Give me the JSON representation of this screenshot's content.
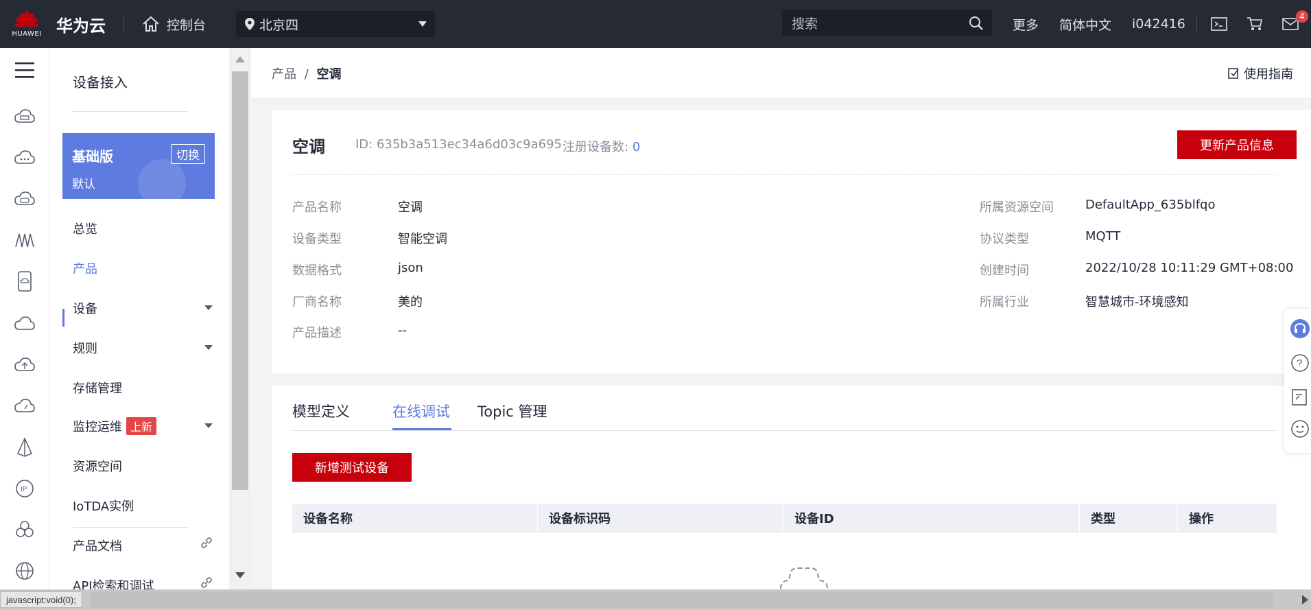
{
  "header": {
    "logo_text": "HUAWEI",
    "brand": "华为云",
    "console": "控制台",
    "region": "北京四",
    "search_placeholder": "搜索",
    "more": "更多",
    "language": "简体中文",
    "user": "i042416",
    "mail_badge": "4",
    "colors": {
      "bar": "#252a34",
      "logo_red": "#c7000b"
    }
  },
  "sidebar": {
    "title": "设备接入",
    "edition": {
      "name": "基础版",
      "sub": "默认",
      "switch": "切换"
    },
    "items": [
      {
        "label": "总览"
      },
      {
        "label": "产品",
        "active": true
      },
      {
        "label": "设备",
        "expandable": true
      },
      {
        "label": "规则",
        "expandable": true
      },
      {
        "label": "存储管理"
      },
      {
        "label": "监控运维",
        "tag": "上新",
        "expandable": true
      },
      {
        "label": "资源空间"
      },
      {
        "label": "IoTDA实例"
      },
      {
        "label": "产品文档",
        "external": true
      },
      {
        "label": "API检索和调试",
        "external": true
      }
    ],
    "accent": "#5e7ce0"
  },
  "breadcrumb": {
    "parent": "产品",
    "separator": "/",
    "current": "空调"
  },
  "guide": "使用指南",
  "product": {
    "name": "空调",
    "id_text": "ID: 635b3a513ec34a6d03c9a695",
    "reg_label": "注册设备数:",
    "reg_count": "0",
    "update_button": "更新产品信息",
    "fields_left": [
      {
        "k": "产品名称",
        "v": "空调"
      },
      {
        "k": "设备类型",
        "v": "智能空调"
      },
      {
        "k": "数据格式",
        "v": "json"
      },
      {
        "k": "厂商名称",
        "v": "美的"
      },
      {
        "k": "产品描述",
        "v": "--"
      }
    ],
    "fields_right": [
      {
        "k": "所属资源空间",
        "v": "DefaultApp_635blfqo"
      },
      {
        "k": "协议类型",
        "v": "MQTT"
      },
      {
        "k": "创建时间",
        "v": "2022/10/28 10:11:29 GMT+08:00"
      },
      {
        "k": "所属行业",
        "v": "智慧城市-环境感知"
      }
    ]
  },
  "tabs": [
    {
      "label": "模型定义"
    },
    {
      "label": "在线调试",
      "active": true
    },
    {
      "label": "Topic 管理"
    }
  ],
  "add_device_button": "新增测试设备",
  "table": {
    "columns": [
      "设备名称",
      "设备标识码",
      "设备ID",
      "类型",
      "操作"
    ]
  },
  "statusbar": {
    "text": "javascript:void(0);"
  },
  "primary_red": "#c7000b"
}
